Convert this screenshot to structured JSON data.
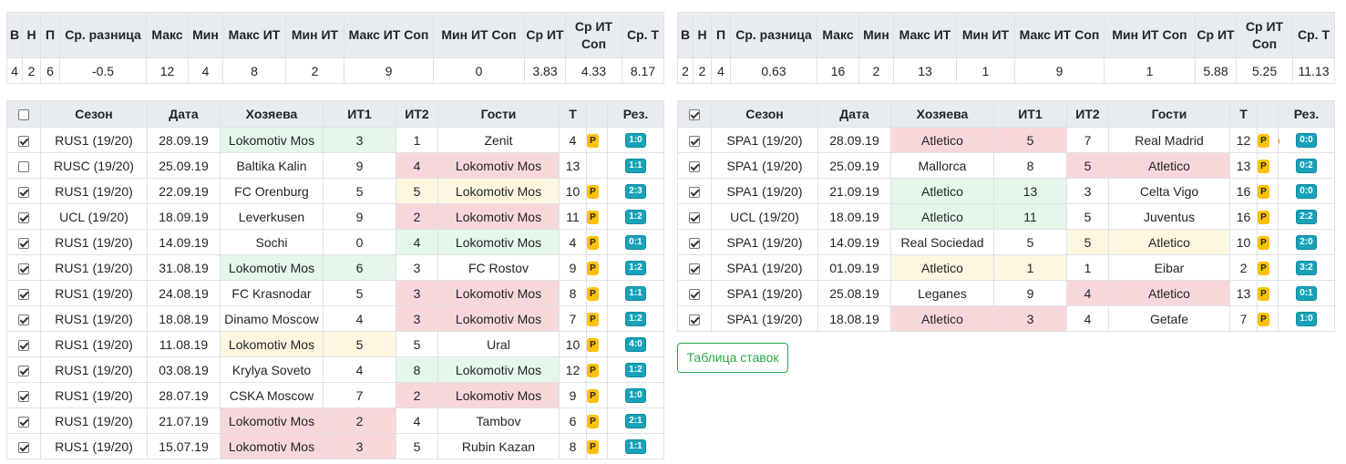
{
  "stats_headers": [
    "В",
    "Н",
    "П",
    "Ср. разница",
    "Макс",
    "Мин",
    "Макс ИТ",
    "Мин ИТ",
    "Макс ИТ Соп",
    "Мин ИТ Соп",
    "Ср ИТ",
    "Ср ИТ Соп",
    "Ср. Т"
  ],
  "left_stats": [
    "4",
    "2",
    "6",
    "-0.5",
    "12",
    "4",
    "8",
    "2",
    "9",
    "0",
    "3.83",
    "4.33",
    "8.17"
  ],
  "right_stats": [
    "2",
    "2",
    "4",
    "0.63",
    "16",
    "2",
    "13",
    "1",
    "9",
    "1",
    "5.88",
    "5.25",
    "11.13"
  ],
  "games_headers": {
    "season": "Сезон",
    "date": "Дата",
    "home": "Хозяева",
    "it1": "ИТ1",
    "it2": "ИТ2",
    "away": "Гости",
    "total": "Т",
    "result": "Рез."
  },
  "left_games": [
    {
      "checked": true,
      "season": "RUS1 (19/20)",
      "date": "28.09.19",
      "home": "Lokomotiv Mos",
      "it1": "3",
      "it2": "1",
      "away": "Zenit",
      "total": "4",
      "p": "P",
      "result": "1:0",
      "hl": "home",
      "hc": "green"
    },
    {
      "checked": false,
      "season": "RUSC (19/20)",
      "date": "25.09.19",
      "home": "Baltika Kalin",
      "it1": "9",
      "it2": "4",
      "away": "Lokomotiv Mos",
      "total": "13",
      "p": "",
      "result": "1:1",
      "hl": "away",
      "hc": "red"
    },
    {
      "checked": true,
      "season": "RUS1 (19/20)",
      "date": "22.09.19",
      "home": "FC Orenburg",
      "it1": "5",
      "it2": "5",
      "away": "Lokomotiv Mos",
      "total": "10",
      "p": "P",
      "result": "2:3",
      "hl": "away",
      "hc": "yellow"
    },
    {
      "checked": true,
      "season": "UCL (19/20)",
      "date": "18.09.19",
      "home": "Leverkusen",
      "it1": "9",
      "it2": "2",
      "away": "Lokomotiv Mos",
      "total": "11",
      "p": "P",
      "result": "1:2",
      "hl": "away",
      "hc": "red"
    },
    {
      "checked": true,
      "season": "RUS1 (19/20)",
      "date": "14.09.19",
      "home": "Sochi",
      "it1": "0",
      "it2": "4",
      "away": "Lokomotiv Mos",
      "total": "4",
      "p": "P",
      "result": "0:1",
      "hl": "away",
      "hc": "green"
    },
    {
      "checked": true,
      "season": "RUS1 (19/20)",
      "date": "31.08.19",
      "home": "Lokomotiv Mos",
      "it1": "6",
      "it2": "3",
      "away": "FC Rostov",
      "total": "9",
      "p": "P",
      "result": "1:2",
      "hl": "home",
      "hc": "green"
    },
    {
      "checked": true,
      "season": "RUS1 (19/20)",
      "date": "24.08.19",
      "home": "FC Krasnodar",
      "it1": "5",
      "it2": "3",
      "away": "Lokomotiv Mos",
      "total": "8",
      "p": "P",
      "result": "1:1",
      "hl": "away",
      "hc": "red"
    },
    {
      "checked": true,
      "season": "RUS1 (19/20)",
      "date": "18.08.19",
      "home": "Dinamo Moscow",
      "it1": "4",
      "it2": "3",
      "away": "Lokomotiv Mos",
      "total": "7",
      "p": "P",
      "result": "1:2",
      "hl": "away",
      "hc": "red"
    },
    {
      "checked": true,
      "season": "RUS1 (19/20)",
      "date": "11.08.19",
      "home": "Lokomotiv Mos",
      "it1": "5",
      "it2": "5",
      "away": "Ural",
      "total": "10",
      "p": "P",
      "result": "4:0",
      "hl": "home",
      "hc": "yellow"
    },
    {
      "checked": true,
      "season": "RUS1 (19/20)",
      "date": "03.08.19",
      "home": "Krylya Soveto",
      "it1": "4",
      "it2": "8",
      "away": "Lokomotiv Mos",
      "total": "12",
      "p": "P",
      "result": "1:2",
      "hl": "away",
      "hc": "green"
    },
    {
      "checked": true,
      "season": "RUS1 (19/20)",
      "date": "28.07.19",
      "home": "CSKA Moscow",
      "it1": "7",
      "it2": "2",
      "away": "Lokomotiv Mos",
      "total": "9",
      "p": "P",
      "result": "1:0",
      "hl": "away",
      "hc": "red"
    },
    {
      "checked": true,
      "season": "RUS1 (19/20)",
      "date": "21.07.19",
      "home": "Lokomotiv Mos",
      "it1": "2",
      "it2": "4",
      "away": "Tambov",
      "total": "6",
      "p": "P",
      "result": "2:1",
      "hl": "home",
      "hc": "red"
    },
    {
      "checked": true,
      "season": "RUS1 (19/20)",
      "date": "15.07.19",
      "home": "Lokomotiv Mos",
      "it1": "3",
      "it2": "5",
      "away": "Rubin Kazan",
      "total": "8",
      "p": "P",
      "result": "1:1",
      "hl": "home",
      "hc": "red"
    }
  ],
  "right_games": [
    {
      "checked": true,
      "season": "SPA1 (19/20)",
      "date": "28.09.19",
      "home": "Atletico",
      "it1": "5",
      "it2": "7",
      "away": "Real Madrid",
      "total": "12",
      "p": "P",
      "fire": true,
      "result": "0:0",
      "hl": "home",
      "hc": "red"
    },
    {
      "checked": true,
      "season": "SPA1 (19/20)",
      "date": "25.09.19",
      "home": "Mallorca",
      "it1": "8",
      "it2": "5",
      "away": "Atletico",
      "total": "13",
      "p": "P",
      "result": "0:2",
      "hl": "away",
      "hc": "red"
    },
    {
      "checked": true,
      "season": "SPA1 (19/20)",
      "date": "21.09.19",
      "home": "Atletico",
      "it1": "13",
      "it2": "3",
      "away": "Celta Vigo",
      "total": "16",
      "p": "P",
      "result": "0:0",
      "hl": "home",
      "hc": "green"
    },
    {
      "checked": true,
      "season": "UCL (19/20)",
      "date": "18.09.19",
      "home": "Atletico",
      "it1": "11",
      "it2": "5",
      "away": "Juventus",
      "total": "16",
      "p": "P",
      "result": "2:2",
      "hl": "home",
      "hc": "green"
    },
    {
      "checked": true,
      "season": "SPA1 (19/20)",
      "date": "14.09.19",
      "home": "Real Sociedad",
      "it1": "5",
      "it2": "5",
      "away": "Atletico",
      "total": "10",
      "p": "P",
      "result": "2:0",
      "hl": "away",
      "hc": "yellow"
    },
    {
      "checked": true,
      "season": "SPA1 (19/20)",
      "date": "01.09.19",
      "home": "Atletico",
      "it1": "1",
      "it2": "1",
      "away": "Eibar",
      "total": "2",
      "p": "P",
      "result": "3:2",
      "hl": "home",
      "hc": "yellow"
    },
    {
      "checked": true,
      "season": "SPA1 (19/20)",
      "date": "25.08.19",
      "home": "Leganes",
      "it1": "9",
      "it2": "4",
      "away": "Atletico",
      "total": "13",
      "p": "P",
      "result": "0:1",
      "hl": "away",
      "hc": "red"
    },
    {
      "checked": true,
      "season": "SPA1 (19/20)",
      "date": "18.08.19",
      "home": "Atletico",
      "it1": "3",
      "it2": "4",
      "away": "Getafe",
      "total": "7",
      "p": "P",
      "result": "1:0",
      "hl": "home",
      "hc": "red"
    }
  ],
  "bets_button": "Таблица ставок",
  "colors": {
    "red": "#f8d7da",
    "green": "#e5f6ea",
    "yellow": "#fff6e0",
    "p_badge": "#ffc107",
    "result_badge": "#17a2b8",
    "button": "#28a745"
  }
}
